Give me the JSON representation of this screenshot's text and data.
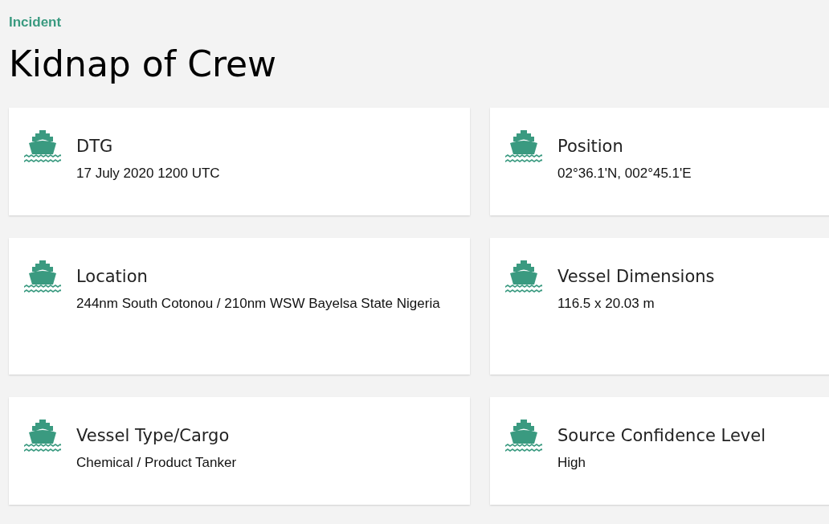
{
  "eyebrow": "Incident",
  "title": "Kidnap of Crew",
  "cards": [
    {
      "label": "DTG",
      "value": "17 July 2020 1200 UTC"
    },
    {
      "label": "Position",
      "value": "02°36.1'N, 002°45.1'E"
    },
    {
      "label": "Location",
      "value": "244nm South Cotonou / 210nm WSW Bayelsa State Nigeria"
    },
    {
      "label": "Vessel Dimensions",
      "value": "116.5 x 20.03 m"
    },
    {
      "label": "Vessel Type/Cargo",
      "value": "Chemical / Product Tanker"
    },
    {
      "label": "Source Confidence Level",
      "value": "High"
    }
  ]
}
